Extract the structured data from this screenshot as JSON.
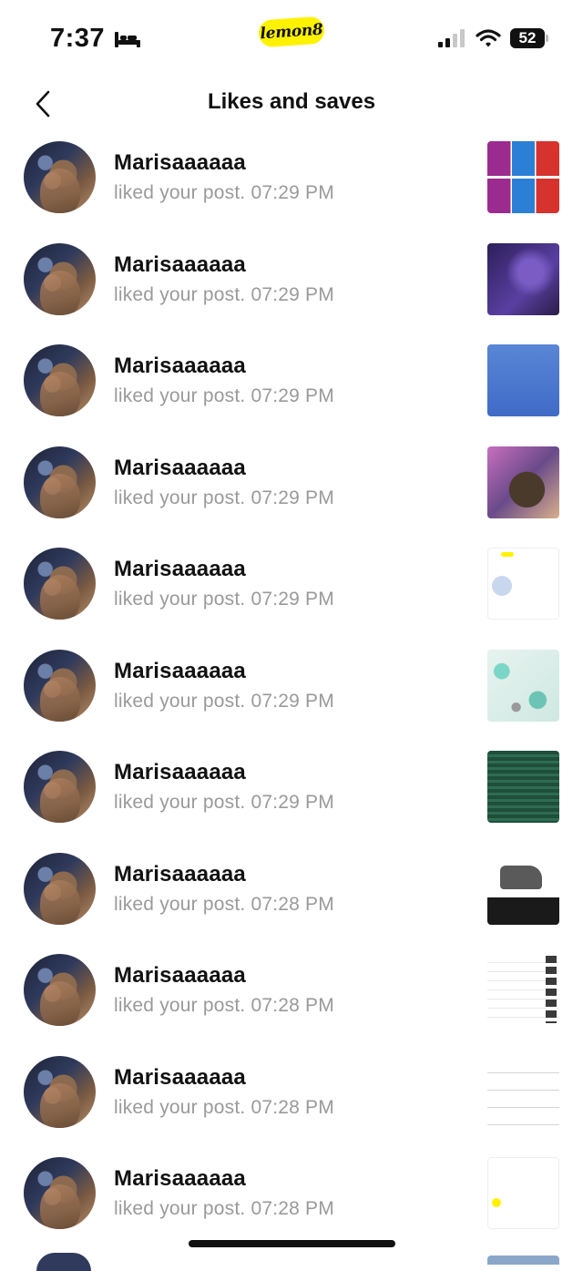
{
  "status_bar": {
    "time": "7:37",
    "sleep_icon": "bed-icon",
    "brand": "lemon8",
    "signal_icon": "signal-bars-icon",
    "wifi_icon": "wifi-icon",
    "battery": "52"
  },
  "header": {
    "back_icon": "chevron-left-icon",
    "title": "Likes and saves"
  },
  "notifications": [
    {
      "user": "Marisaaaaaa",
      "activity": "liked your post. 07:29 PM"
    },
    {
      "user": "Marisaaaaaa",
      "activity": "liked your post. 07:29 PM"
    },
    {
      "user": "Marisaaaaaa",
      "activity": "liked your post. 07:29 PM"
    },
    {
      "user": "Marisaaaaaa",
      "activity": "liked your post. 07:29 PM"
    },
    {
      "user": "Marisaaaaaa",
      "activity": "liked your post. 07:29 PM"
    },
    {
      "user": "Marisaaaaaa",
      "activity": "liked your post. 07:29 PM"
    },
    {
      "user": "Marisaaaaaa",
      "activity": "liked your post. 07:29 PM"
    },
    {
      "user": "Marisaaaaaa",
      "activity": "liked your post. 07:28 PM"
    },
    {
      "user": "Marisaaaaaa",
      "activity": "liked your post. 07:28 PM"
    },
    {
      "user": "Marisaaaaaa",
      "activity": "liked your post. 07:28 PM"
    },
    {
      "user": "Marisaaaaaa",
      "activity": "liked your post. 07:28 PM"
    }
  ],
  "colors": {
    "brand_yellow": "#fff200",
    "secondary_text": "#9a9a9a",
    "primary_text": "#111111"
  }
}
